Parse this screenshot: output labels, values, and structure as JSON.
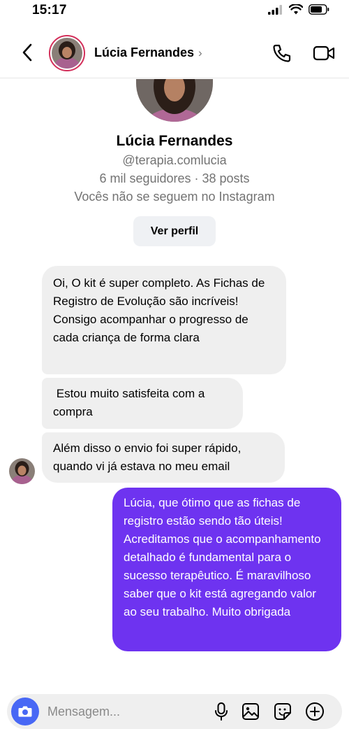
{
  "status_bar": {
    "time": "15:17",
    "icons": [
      "signal-icon",
      "wifi-icon",
      "battery-icon"
    ]
  },
  "header": {
    "contact_name": "Lúcia Fernandes",
    "chevron": "›",
    "icons": [
      "back-arrow-icon",
      "phone-icon",
      "video-camera-icon"
    ]
  },
  "profile": {
    "name": "Lúcia Fernandes",
    "handle": "@terapia.comlucia",
    "stats": "6 mil seguidores · 38 posts",
    "follow_status": "Vocês não se seguem no Instagram",
    "view_profile_label": "Ver perfil"
  },
  "messages": [
    {
      "sender": "incoming",
      "text": "Oi, O kit é super completo. As Fichas de Registro de Evolução são incríveis! Consigo acompanhar o progresso de cada criança de forma clara"
    },
    {
      "sender": "incoming",
      "text": " Estou muito satisfeita com a compra"
    },
    {
      "sender": "incoming",
      "text": "Além disso o envio foi super rápido, quando vi já estava no meu email"
    },
    {
      "sender": "outgoing",
      "text": "Lúcia, que ótimo que as fichas de registro estão sendo tão úteis! Acreditamos que o acompanhamento detalhado é fundamental para o sucesso terapêutico. É maravilhoso saber que o kit está agregando valor ao seu trabalho. Muito obrigada"
    }
  ],
  "composer": {
    "placeholder": "Mensagem...",
    "icons": [
      "camera-icon",
      "microphone-icon",
      "gallery-icon",
      "sticker-icon",
      "add-icon"
    ]
  },
  "colors": {
    "outgoing_bubble": "#6e33f0",
    "incoming_bubble": "#efefef",
    "camera_button": "#4868f5",
    "story_ring": "#d32f5a"
  }
}
